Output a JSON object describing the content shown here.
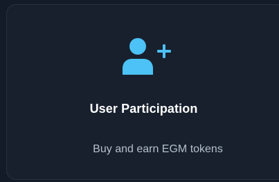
{
  "card": {
    "icon": "user-plus-icon",
    "title": "User Participation",
    "description": "Buy and earn EGM tokens"
  },
  "colors": {
    "page_background": "#131b28",
    "card_background": "#18202e",
    "accent": "#4cc2f6",
    "title": "#ffffff",
    "description": "#b6bfcc"
  }
}
